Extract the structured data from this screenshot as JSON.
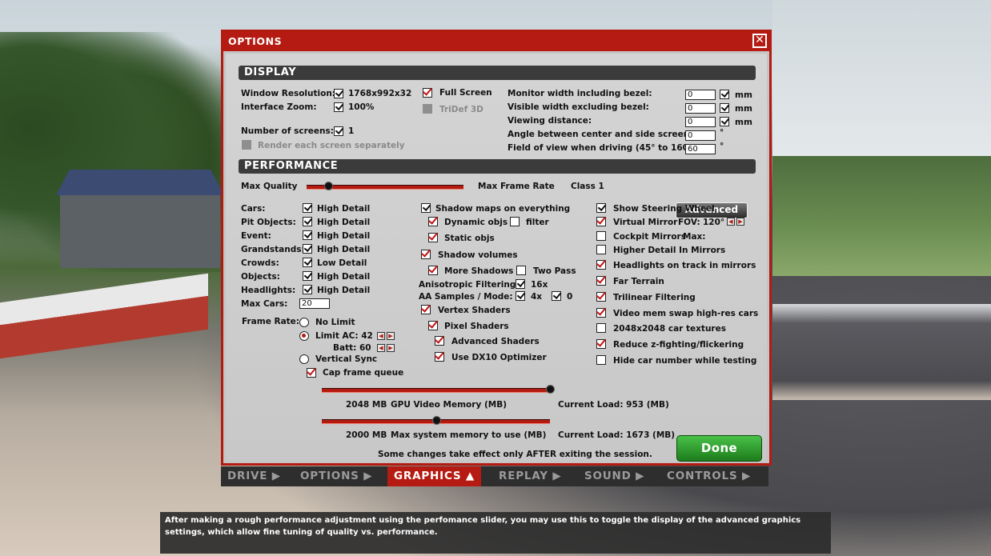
{
  "window": {
    "title": "OPTIONS",
    "close_icon": "close-icon"
  },
  "display": {
    "header": "DISPLAY",
    "window_resolution_label": "Window Resolution:",
    "window_resolution_value": "1768x992x32",
    "full_screen_label": "Full Screen",
    "full_screen_checked": true,
    "interface_zoom_label": "Interface Zoom:",
    "interface_zoom_value": "100%",
    "tridef_label": "TriDef 3D",
    "num_screens_label": "Number of screens:",
    "num_screens_value": "1",
    "render_each_label": "Render each screen separately",
    "monitor_width_label": "Monitor width including bezel:",
    "monitor_width_value": "0",
    "visible_width_label": "Visible width excluding bezel:",
    "visible_width_value": "0",
    "viewing_distance_label": "Viewing distance:",
    "viewing_distance_value": "0",
    "angle_label": "Angle between center and side screens:",
    "angle_value": "0",
    "fov_label": "Field of view when driving (45° to 160°):",
    "fov_value": "60",
    "unit_mm": "mm",
    "unit_deg": "°"
  },
  "performance": {
    "header": "PERFORMANCE",
    "max_quality_label": "Max Quality",
    "max_frame_rate_label": "Max Frame Rate",
    "class_label": "Class 1",
    "quality_slider_fraction": 0.14,
    "advanced_button": "Advanced",
    "rows": [
      {
        "label": "Cars:",
        "value": "High Detail"
      },
      {
        "label": "Pit Objects:",
        "value": "High Detail"
      },
      {
        "label": "Event:",
        "value": "High Detail"
      },
      {
        "label": "Grandstands:",
        "value": "High Detail"
      },
      {
        "label": "Crowds:",
        "value": "Low Detail"
      },
      {
        "label": "Objects:",
        "value": "High Detail"
      },
      {
        "label": "Headlights:",
        "value": "High Detail"
      }
    ],
    "max_cars_label": "Max Cars:",
    "max_cars_value": "20",
    "frame_rate_label": "Frame Rate:",
    "no_limit": "No Limit",
    "limit_ac": "Limit AC: 42",
    "batt": "Batt: 60",
    "vertical_sync": "Vertical Sync",
    "cap_frame_queue": "Cap frame queue",
    "shadow_maps": "Shadow maps on everything",
    "dynamic_objs": "Dynamic objs",
    "filter": "filter",
    "static_objs": "Static objs",
    "shadow_volumes": "Shadow volumes",
    "more_shadows": "More Shadows",
    "two_pass": "Two Pass",
    "aniso_label": "Anisotropic Filtering:",
    "aniso_value": "16x",
    "aa_label": "AA Samples / Mode:",
    "aa_samples": "4x",
    "aa_mode": "0",
    "vertex_shaders": "Vertex Shaders",
    "pixel_shaders": "Pixel Shaders",
    "advanced_shaders": "Advanced Shaders",
    "dx10": "Use DX10 Optimizer",
    "show_steering": "Show Steering Wheel",
    "virtual_mirror": "Virtual Mirror",
    "fov_short": "FOV:",
    "mirror_fov": "120°",
    "cockpit_mirrors": "Cockpit Mirrors",
    "cockpit_max": "Max:",
    "higher_detail_mirrors": "Higher Detail In Mirrors",
    "headlights_mirrors": "Headlights on track in mirrors",
    "far_terrain": "Far Terrain",
    "trilinear": "Trilinear Filtering",
    "video_mem_swap": "Video mem swap high-res cars",
    "car_textures": "2048x2048 car textures",
    "reduce_z": "Reduce z-fighting/flickering",
    "hide_car_number": "Hide car number while testing",
    "gpu_mem_value": "2048 MB",
    "gpu_mem_label": "GPU Video Memory (MB)",
    "gpu_current_load": "Current Load: 953 (MB)",
    "gpu_slider_fraction": 1.0,
    "sys_mem_value": "2000 MB",
    "sys_mem_label": "Max system memory to use (MB)",
    "sys_current_load": "Current Load: 1673 (MB)",
    "sys_slider_fraction": 0.5,
    "notice": "Some changes take effect only AFTER exiting the session.",
    "done_button": "Done"
  },
  "tabs": [
    "DRIVE",
    "OPTIONS",
    "GRAPHICS",
    "REPLAY",
    "SOUND",
    "CONTROLS"
  ],
  "active_tab": "GRAPHICS",
  "tooltip": "After making a rough performance adjustment using the perfomance slider, you may use this to toggle the display of the advanced graphics settings, which allow fine tuning of quality vs. performance.",
  "colors": {
    "accent": "#b51b12",
    "done": "#2f9e2d"
  }
}
